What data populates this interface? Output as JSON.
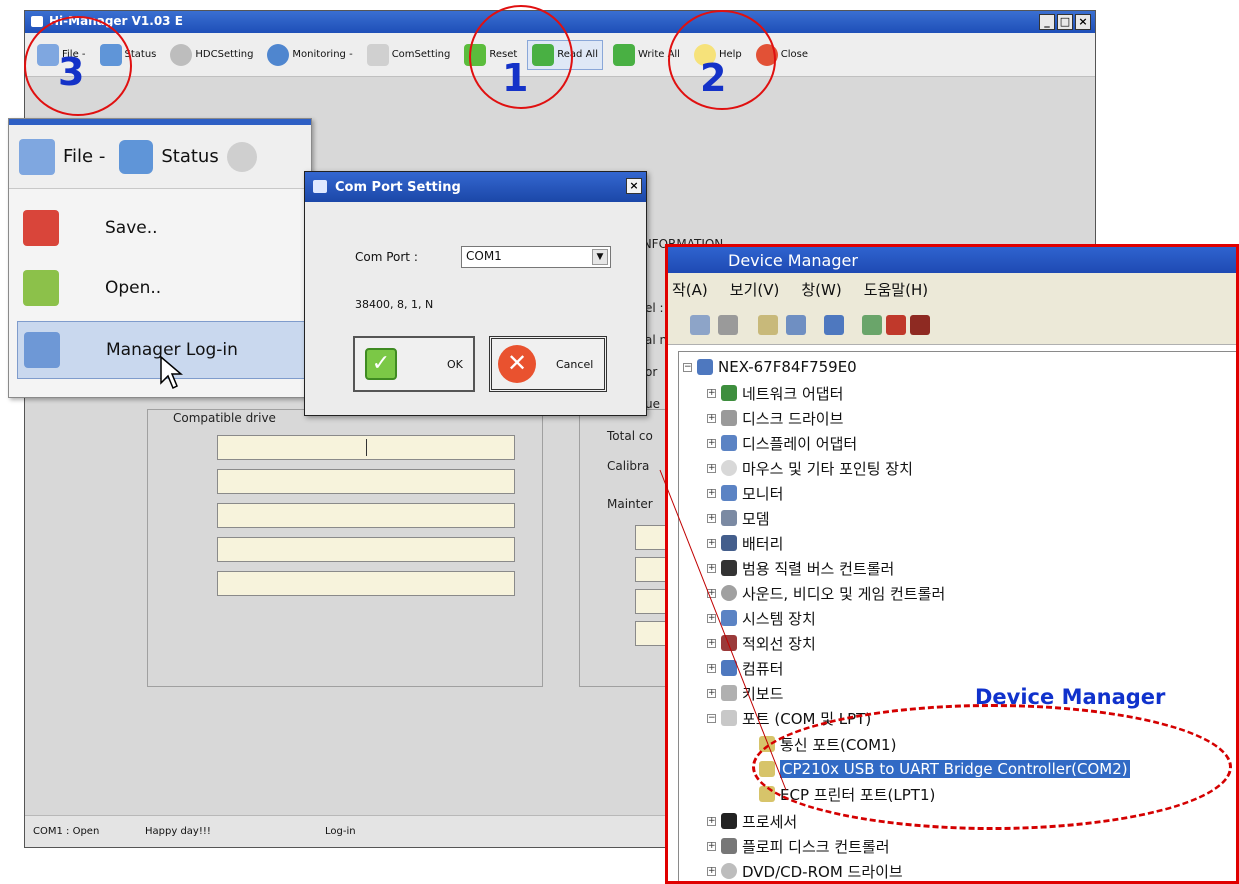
{
  "main_window": {
    "title": "Hi-Manager  V1.03 E",
    "toolbar": [
      {
        "label": "File -"
      },
      {
        "label": "Status"
      },
      {
        "label": "HDCSetting"
      },
      {
        "label": "Monitoring -"
      },
      {
        "label": "ComSetting"
      },
      {
        "label": "Reset"
      },
      {
        "label": "Read All"
      },
      {
        "label": "Write All"
      },
      {
        "label": "Help"
      },
      {
        "label": "Close"
      }
    ],
    "labels": {
      "compatible": "Compatible drive",
      "info_header": "R INFORMATION",
      "el": "el :",
      "al": "al n",
      "or": "or",
      "ue": "ue",
      "total": "Total co",
      "calib": "Calibra",
      "maint": "Mainter"
    },
    "statusbar": {
      "port": "COM1 : Open",
      "message": "Happy day!!!",
      "login": "Log-in"
    }
  },
  "file_popup": {
    "file_button": "File -",
    "status_button": "Status",
    "items": [
      {
        "label": "Save.."
      },
      {
        "label": "Open.."
      },
      {
        "label": "Manager Log-in"
      }
    ]
  },
  "com_dialog": {
    "title": "Com Port Setting",
    "com_port_label": "Com Port :",
    "com_port_value": "COM1",
    "settings": "38400, 8, 1, N",
    "ok": "OK",
    "cancel": "Cancel"
  },
  "device_manager": {
    "title": "Device  Manager",
    "menu": [
      "작(A)",
      "보기(V)",
      "창(W)",
      "도움말(H)"
    ],
    "root": "NEX-67F84F759E0",
    "nodes": [
      "네트워크 어댑터",
      "디스크 드라이브",
      "디스플레이 어댑터",
      "마우스 및 기타 포인팅 장치",
      "모니터",
      "모뎀",
      "배터리",
      "범용 직렬 버스 컨트롤러",
      "사운드, 비디오 및 게임 컨트롤러",
      "시스템 장치",
      "적외선 장치",
      "컴퓨터",
      "키보드",
      "포트 (COM 및 LPT)"
    ],
    "ports": [
      "통신 포트(COM1)",
      "CP210x USB to UART Bridge Controller(COM2)",
      "ECP 프린터 포트(LPT1)"
    ],
    "after_ports": [
      "프로세서",
      "플로피 디스크 컨트롤러",
      "DVD/CD-ROM 드라이브"
    ],
    "caption": "Device  Manager"
  },
  "annotations": {
    "n1": "1",
    "n2": "2",
    "n3": "3"
  },
  "colors": {
    "title_blue": "#1e4fb8",
    "highlight_red": "#e00000",
    "selection_blue": "#316ac5",
    "number_blue": "#1432c8"
  }
}
